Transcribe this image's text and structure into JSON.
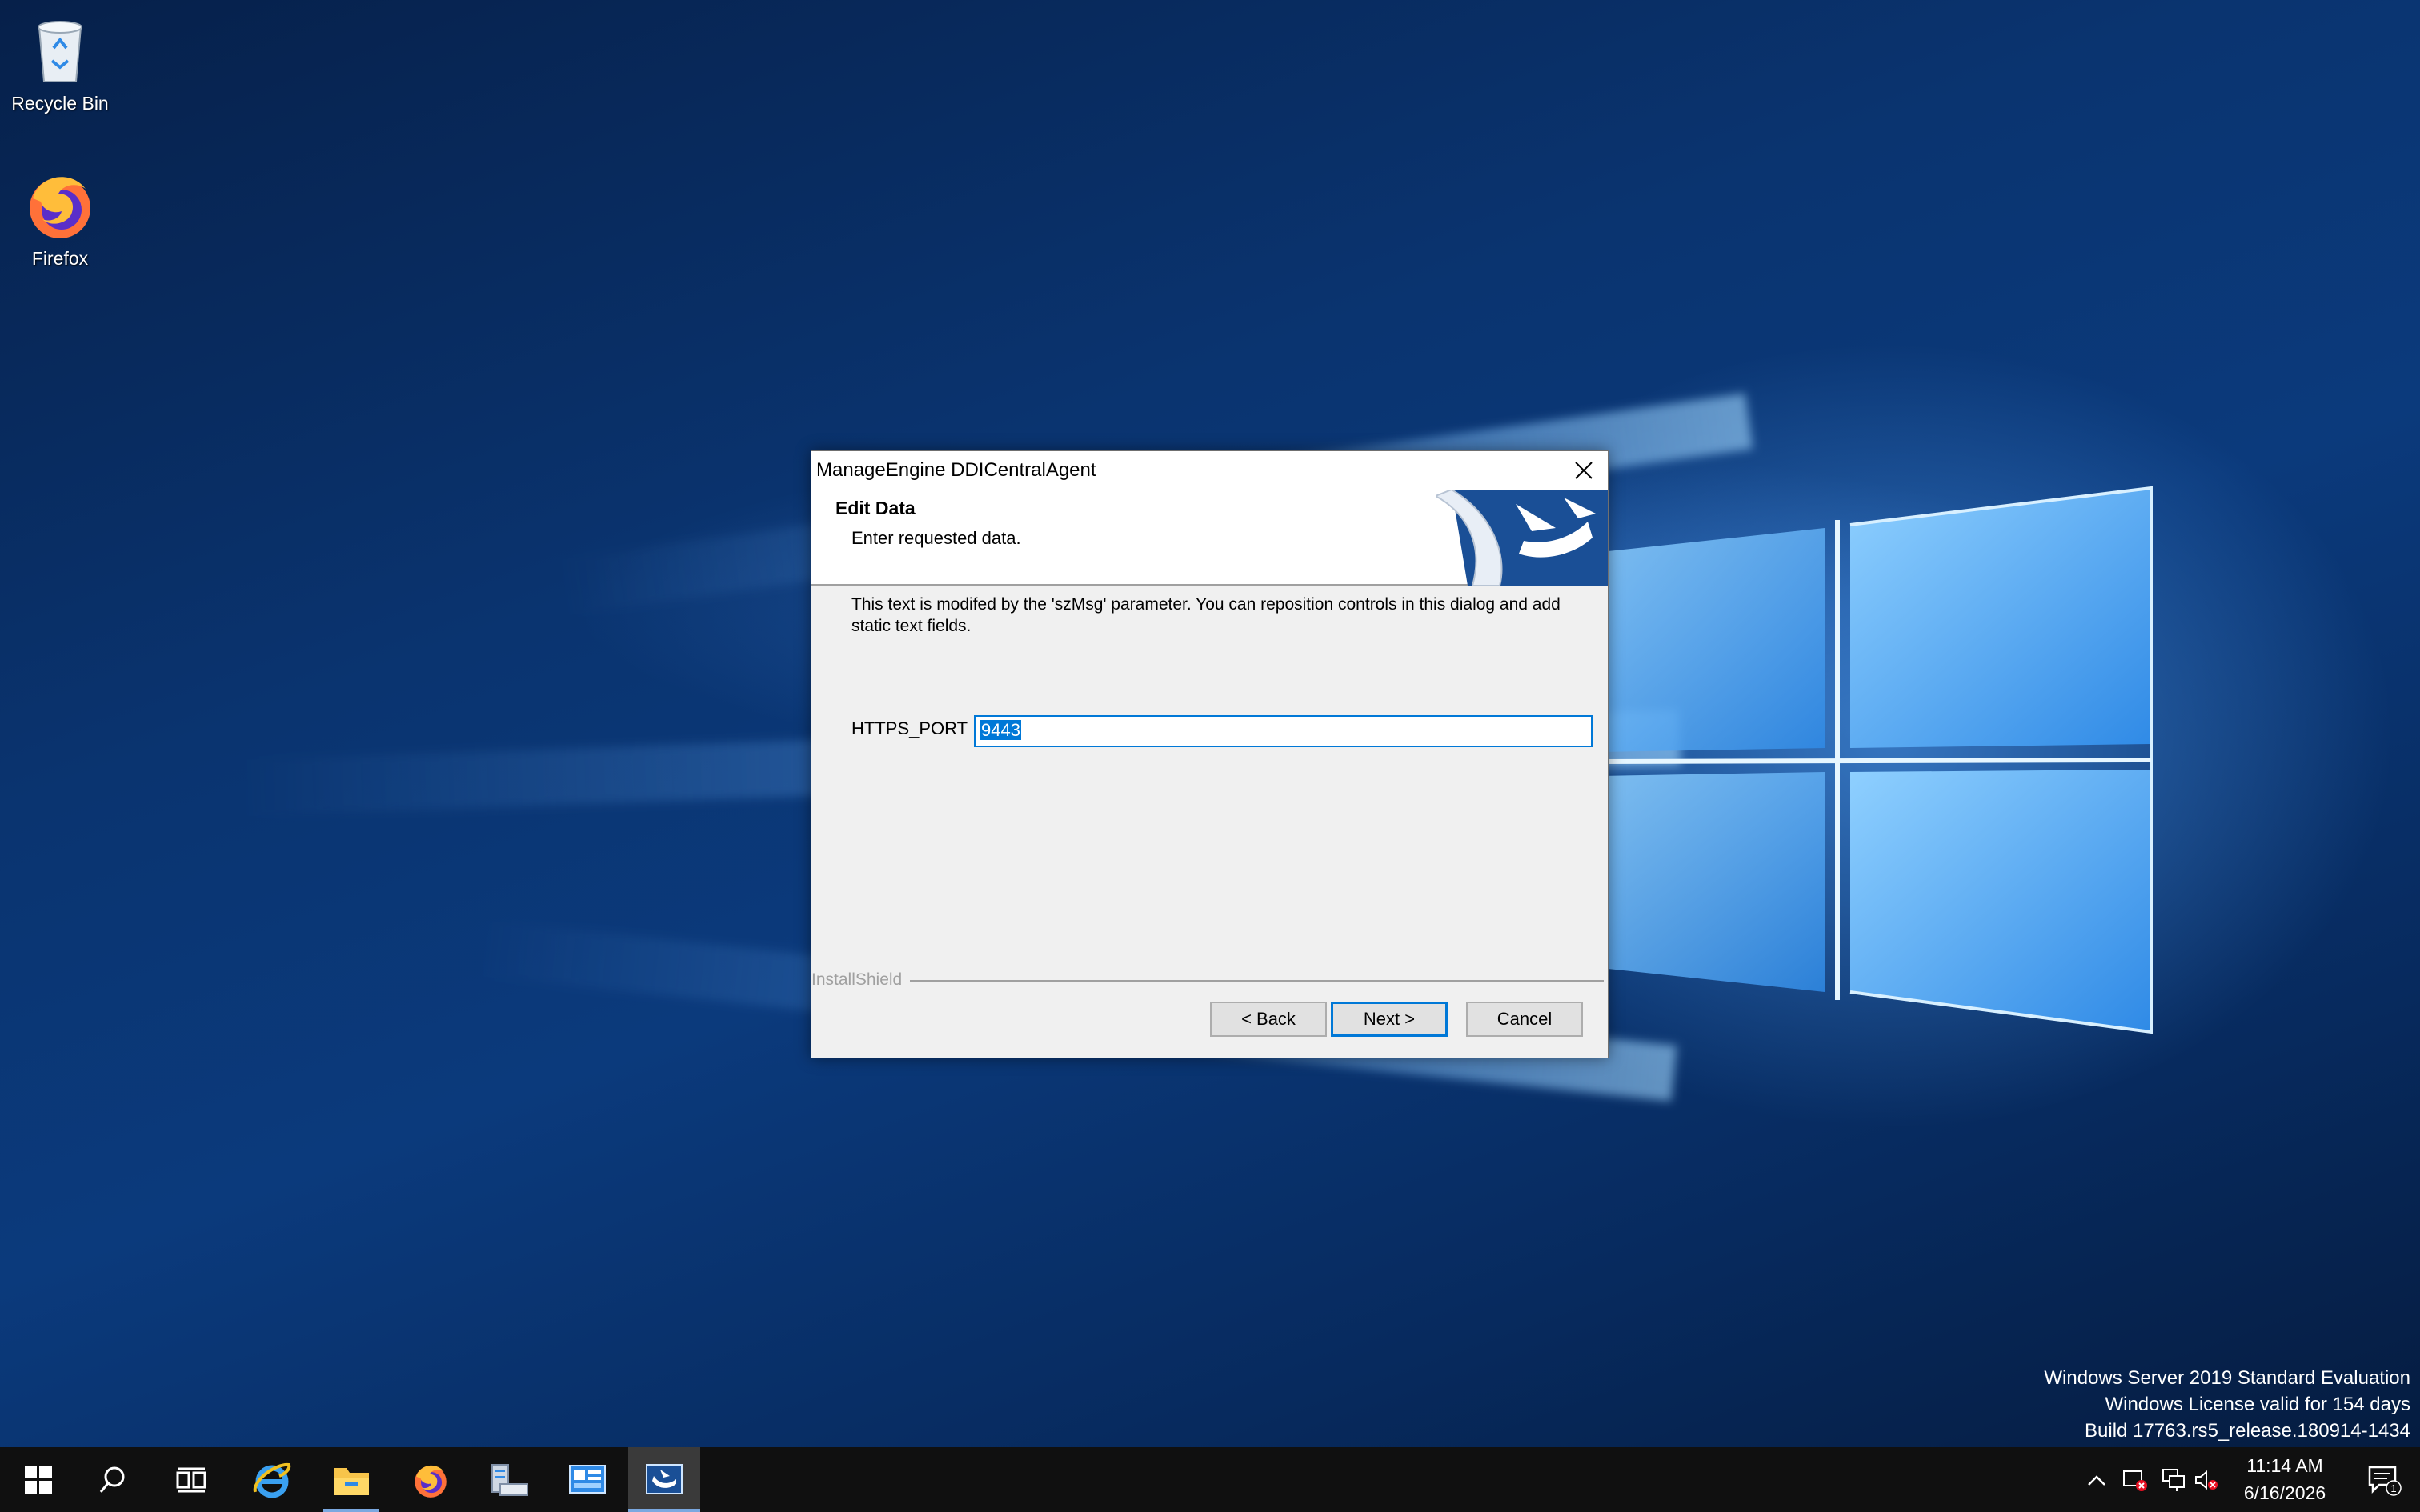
{
  "desktop": {
    "icons": [
      {
        "label": "Recycle Bin"
      },
      {
        "label": "Firefox"
      }
    ],
    "watermark": {
      "line1": "Windows Server 2019 Standard Evaluation",
      "line2": "Windows License valid for 154 days",
      "line3": "Build 17763.rs5_release.180914-1434"
    }
  },
  "dialog": {
    "title": "ManageEngine DDICentralAgent",
    "header_title": "Edit Data",
    "header_subtitle": "Enter requested data.",
    "message": "This text is modifed by the 'szMsg' parameter.  You can reposition controls in this dialog and add static text fields.",
    "field_label": "HTTPS_PORT",
    "field_value": "9443",
    "brand": "InstallShield",
    "buttons": {
      "back": "< Back",
      "next": "Next >",
      "cancel": "Cancel"
    }
  },
  "taskbar": {
    "items": [
      "start",
      "search",
      "task-view",
      "internet-explorer",
      "file-explorer",
      "firefox",
      "server-manager",
      "control-panel",
      "installer"
    ],
    "clock": {
      "time": "11:14 AM",
      "date": "6/16/2026"
    },
    "notification_count": "1"
  }
}
